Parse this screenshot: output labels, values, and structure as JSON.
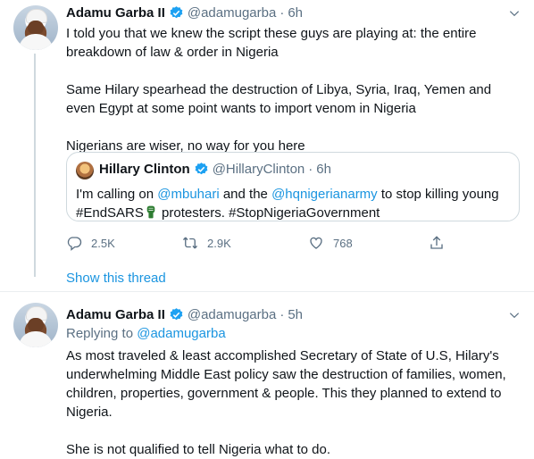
{
  "tweet1": {
    "name": "Adamu Garba II",
    "handle": "@adamugarba",
    "separator": "·",
    "time": "6h",
    "paragraphs": [
      "I told you that we knew the script these guys are playing at: the entire breakdown of law & order in Nigeria",
      "Same Hilary spearhead the destruction of Libya, Syria, Iraq, Yemen and even Egypt at some point wants to import venom in Nigeria",
      "Nigerians are wiser, no way for you here"
    ],
    "quote": {
      "name": "Hillary Clinton",
      "handle": "@HillaryClinton",
      "separator": "·",
      "time": "6h",
      "text_before": "I'm calling on ",
      "mention1": "@mbuhari",
      "text_mid": " and the ",
      "mention2": "@hqnigerianarmy",
      "text_after": " to stop killing young",
      "line2_a": "#EndSARS",
      "line2_b": " protesters. #StopNigeriaGovernment"
    },
    "actions": {
      "reply_count": "2.5K",
      "retweet_count": "2.9K",
      "like_count": "768"
    },
    "show_thread": "Show this thread"
  },
  "tweet2": {
    "name": "Adamu Garba II",
    "handle": "@adamugarba",
    "separator": "·",
    "time": "5h",
    "replying_prefix": "Replying to ",
    "replying_to": "@adamugarba",
    "paragraphs": [
      "As most traveled & least accomplished Secretary of State of U.S, Hilary's underwhelming Middle East policy saw the destruction of families, women, children, properties, government & people. This they planned to extend to Nigeria.",
      "She is not qualified to tell Nigeria what to do."
    ]
  },
  "colors": {
    "accent": "#1b95e0",
    "secondary_text": "#5b7083",
    "verified": "#1da1f2",
    "border": "#cfd9de"
  },
  "icons": [
    "verified-badge-icon",
    "chevron-down-icon",
    "reply-icon",
    "retweet-icon",
    "like-icon",
    "share-icon",
    "raised-fist-emoji"
  ]
}
